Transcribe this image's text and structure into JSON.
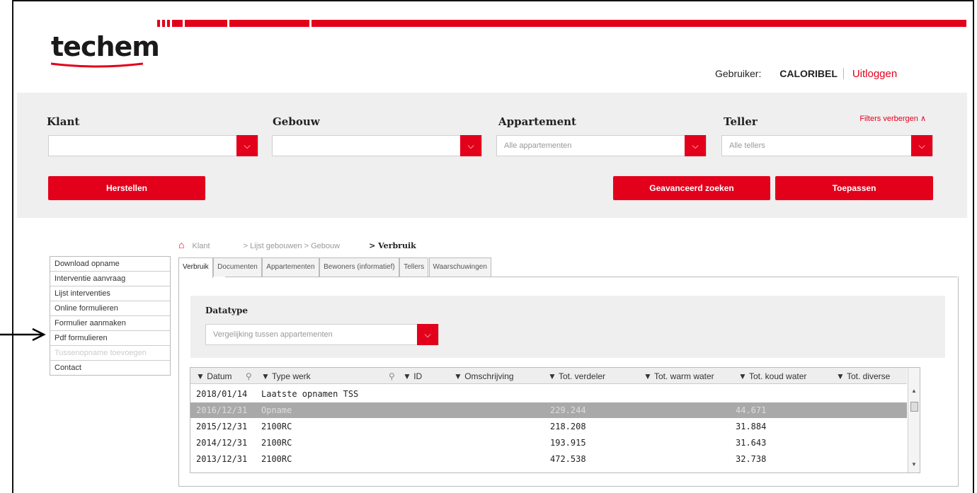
{
  "logo": {
    "text": "techem"
  },
  "header": {
    "user_label": "Gebruiker:",
    "user_name": "CALORIBEL",
    "logout": "Uitloggen"
  },
  "filters": {
    "klant_label": "Klant",
    "gebouw_label": "Gebouw",
    "appartement_label": "Appartement",
    "appartement_value": "Alle appartementen",
    "teller_label": "Teller",
    "teller_value": "Alle tellers",
    "hide": "Filters verbergen",
    "reset_btn": "Herstellen",
    "advanced_btn": "Geavanceerd zoeken",
    "apply_btn": "Toepassen"
  },
  "breadcrumb": {
    "klant": "Klant",
    "middle": "> Lijst gebouwen > Gebouw",
    "current": "> Verbruik"
  },
  "sidemenu": [
    {
      "label": "Download opname",
      "enabled": true
    },
    {
      "label": "Interventie aanvraag",
      "enabled": true
    },
    {
      "label": "Lijst interventies",
      "enabled": true
    },
    {
      "label": "Online formulieren",
      "enabled": true
    },
    {
      "label": "Formulier aanmaken",
      "enabled": true
    },
    {
      "label": "Pdf formulieren",
      "enabled": true
    },
    {
      "label": "Tussenopname toevoegen",
      "enabled": false
    },
    {
      "label": "Contact",
      "enabled": true
    }
  ],
  "tabs": [
    "Verbruik",
    "Documenten",
    "Appartementen",
    "Bewoners (informatief)",
    "Tellers",
    "Waarschuwingen"
  ],
  "datatype": {
    "label": "Datatype",
    "value": "Vergelijking tussen appartementen"
  },
  "grid": {
    "columns": [
      "▼ Datum",
      "▼ Type werk",
      "▼ ID",
      "▼ Omschrijving",
      "▼ Tot. verdeler",
      "▼ Tot. warm water",
      "▼ Tot. koud water",
      "▼ Tot. diverse"
    ],
    "rows": [
      {
        "datum": "2018/01/14",
        "type": "Laatste opnamen TSS",
        "verdeler": "",
        "koud": ""
      },
      {
        "datum": "2016/12/31",
        "type": "Opname",
        "verdeler": "229.244",
        "koud": "44.671"
      },
      {
        "datum": "2015/12/31",
        "type": "2100RC",
        "verdeler": "218.208",
        "koud": "31.884"
      },
      {
        "datum": "2014/12/31",
        "type": "2100RC",
        "verdeler": "193.915",
        "koud": "31.643"
      },
      {
        "datum": "2013/12/31",
        "type": "2100RC",
        "verdeler": "472.538",
        "koud": "32.738"
      }
    ]
  },
  "colors": {
    "accent": "#e3001b",
    "panel_bg": "#efefef"
  }
}
